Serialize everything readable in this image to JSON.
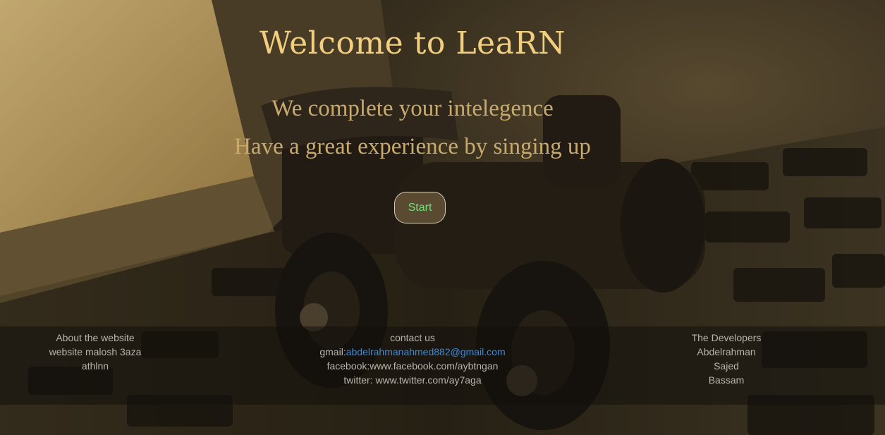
{
  "page": {
    "title": "Welcome to LeaRN",
    "tagline_line1": "We complete your intelegence",
    "tagline_line2": "Have a great experience by singing up",
    "start_label": "Start"
  },
  "footer": {
    "about": {
      "heading": "About the website",
      "line1": "website malosh 3aza",
      "line2": "athlnn"
    },
    "contact": {
      "heading": "contact us",
      "gmail_label": "gmail:",
      "gmail_value": "abdelrahmanahmed882@gmail.com",
      "facebook": "facebook:www.facebook.com/aybtngan",
      "twitter": "twitter: www.twitter.com/ay7aga"
    },
    "developers": {
      "heading": "The Developers",
      "names": [
        "Abdelrahman",
        "Sajed",
        "Bassam"
      ]
    }
  },
  "colors": {
    "title": "#f2cf7e",
    "tagline": "#c9aa6c",
    "button_text": "#6ee07a",
    "link": "#3d88d6"
  },
  "icons": [
    "background-photo"
  ]
}
